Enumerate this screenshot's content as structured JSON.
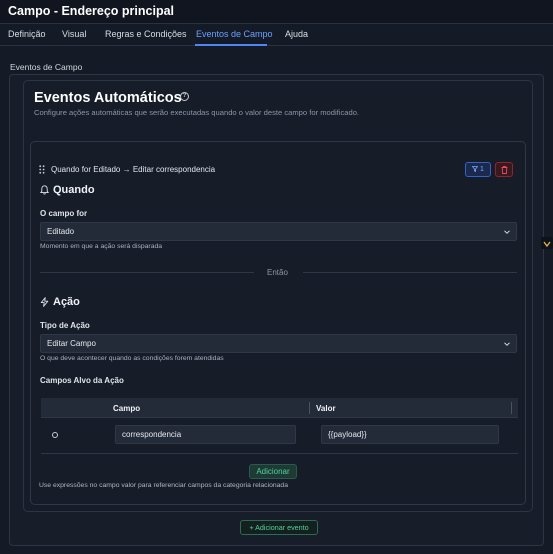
{
  "window": {
    "title": "Campo - Endereço principal"
  },
  "tabs": [
    {
      "label": "Definição"
    },
    {
      "label": "Visual"
    },
    {
      "label": "Regras e Condições"
    },
    {
      "label": "Eventos de Campo"
    },
    {
      "label": "Ajuda"
    }
  ],
  "active_tab": "Eventos de Campo",
  "section_label": "Eventos de Campo",
  "auto": {
    "title": "Eventos Automáticos",
    "description": "Configure ações automáticas que serão executadas quando o valor deste campo for modificado."
  },
  "event": {
    "header": "Quando for Editado → Editar correspondencia",
    "badge_count": "1",
    "when": {
      "heading": "Quando",
      "field_label": "O campo for",
      "selected": "Editado",
      "hint": "Momento em que a ação será disparada"
    },
    "divider": "Então",
    "action": {
      "heading": "Ação",
      "field_label": "Tipo de Ação",
      "selected": "Editar Campo",
      "hint": "O que deve acontecer quando as condições forem atendidas",
      "targets_label": "Campos Alvo da Ação",
      "columns": [
        "Campo",
        "Valor"
      ],
      "rows": [
        {
          "campo": "correspondencia",
          "valor": "{{payload}}"
        }
      ],
      "add_label": "Adicionar",
      "add_hint": "Use expressões no campo valor para referenciar campos da categoria relacionada"
    }
  },
  "add_event_label": "Adicionar evento",
  "colors": {
    "accent_blue": "#4f86f7",
    "accent_green": "#4fd1a1",
    "danger": "#e0505d",
    "background": "#151b26"
  }
}
